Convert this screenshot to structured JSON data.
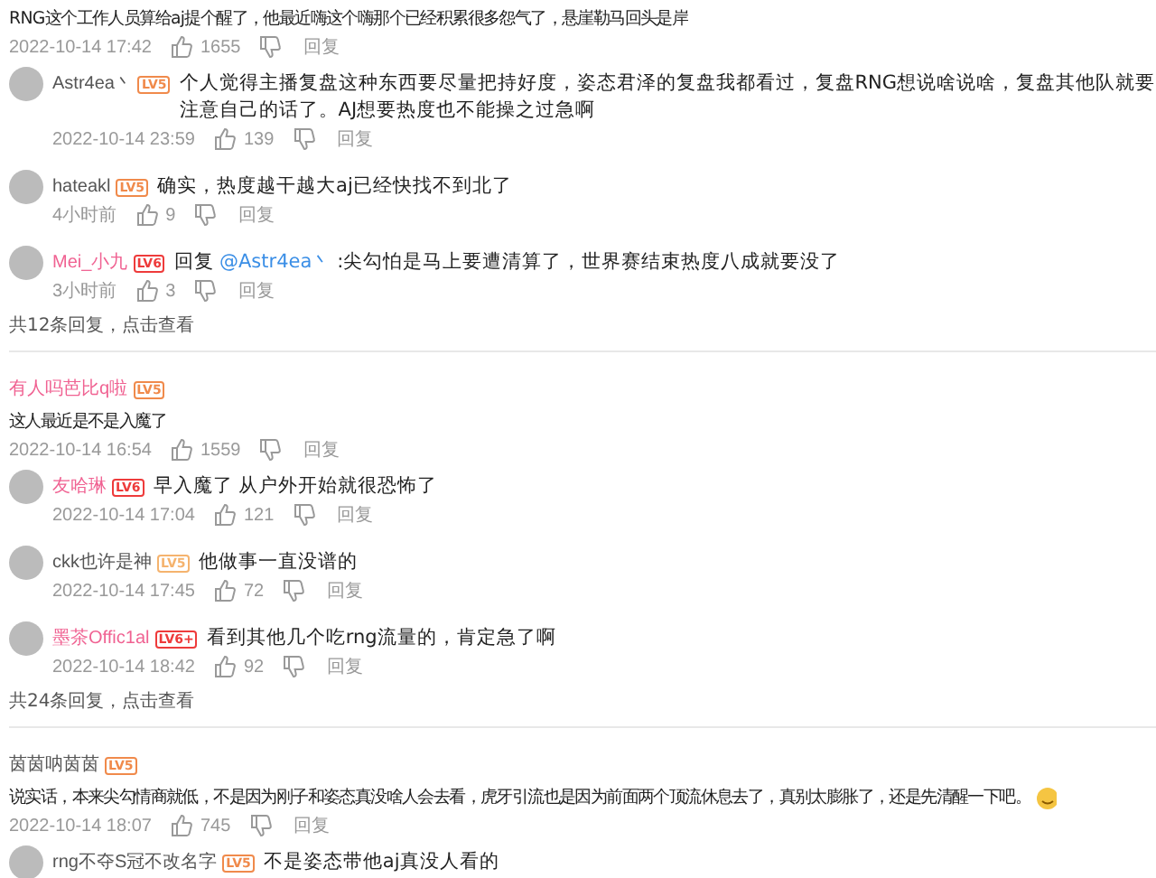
{
  "threads": [
    {
      "text": "RNG这个工作人员算给aj提个醒了，他最近嗨这个嗨那个已经积累很多怨气了，悬崖勒马回头是岸",
      "time": "2022-10-14 17:42",
      "likes": "1655",
      "reply_label": "回复",
      "replies": [
        {
          "name": "Astr4ea丶",
          "vip": false,
          "badge": {
            "text": "LV5",
            "color": "#f08a4b"
          },
          "text": "个人觉得主播复盘这种东西要尽量把持好度，姿态君泽的复盘我都看过，复盘RNG想说啥说啥，复盘其他队就要注意自己的话了。AJ想要热度也不能操之过急啊",
          "time": "2022-10-14 23:59",
          "likes": "139",
          "reply_label": "回复"
        },
        {
          "name": "hateakl",
          "vip": false,
          "badge": {
            "text": "LV5",
            "color": "#f08a4b"
          },
          "text": "确实，热度越干越大aj已经快找不到北了",
          "time": "4小时前",
          "likes": "9",
          "reply_label": "回复"
        },
        {
          "name": "Mei_小九",
          "vip": true,
          "badge": {
            "text": "LV6",
            "color": "#ee3b3b"
          },
          "prefix": "回复",
          "mention": "@Astr4ea丶",
          "text": ":尖勾怕是马上要遭清算了，世界赛结束热度八成就要没了",
          "time": "3小时前",
          "likes": "3",
          "reply_label": "回复"
        }
      ],
      "more": "共12条回复，点击查看"
    },
    {
      "name": "有人吗芭比q啦",
      "vip": true,
      "badge": {
        "text": "LV5",
        "color": "#f08a4b"
      },
      "text": "这人最近是不是入魔了",
      "time": "2022-10-14 16:54",
      "likes": "1559",
      "reply_label": "回复",
      "replies": [
        {
          "name": "友哈琳",
          "vip": true,
          "badge": {
            "text": "LV6",
            "color": "#ee3b3b"
          },
          "text": "早入魔了  从户外开始就很恐怖了",
          "time": "2022-10-14 17:04",
          "likes": "121",
          "reply_label": "回复"
        },
        {
          "name": "ckk也许是神",
          "vip": false,
          "badge": {
            "text": "LV5",
            "color": "#f5b36e"
          },
          "text": "他做事一直没谱的",
          "time": "2022-10-14 17:45",
          "likes": "72",
          "reply_label": "回复"
        },
        {
          "name": "墨茶Offic1al",
          "vip": true,
          "badge": {
            "text": "LV6+",
            "color": "#ee3b3b"
          },
          "text": "看到其他几个吃rng流量的，肯定急了啊",
          "time": "2022-10-14 18:42",
          "likes": "92",
          "reply_label": "回复"
        }
      ],
      "more": "共24条回复，点击查看"
    },
    {
      "name": "茵茵呐茵茵",
      "vip": false,
      "badge": {
        "text": "LV5",
        "color": "#f08a4b"
      },
      "text": "说实话，本来尖勾情商就低，不是因为刚子和姿态真没啥人会去看，虎牙引流也是因为前面两个顶流休息去了，真别太膨胀了，还是先清醒一下吧。",
      "emoji": true,
      "time": "2022-10-14 18:07",
      "likes": "745",
      "reply_label": "回复",
      "replies": [
        {
          "name": "rng不夺S冠不改名字",
          "vip": false,
          "badge": {
            "text": "LV5",
            "color": "#f08a4b"
          },
          "text": "不是姿态带他aj真没人看的"
        }
      ]
    }
  ]
}
